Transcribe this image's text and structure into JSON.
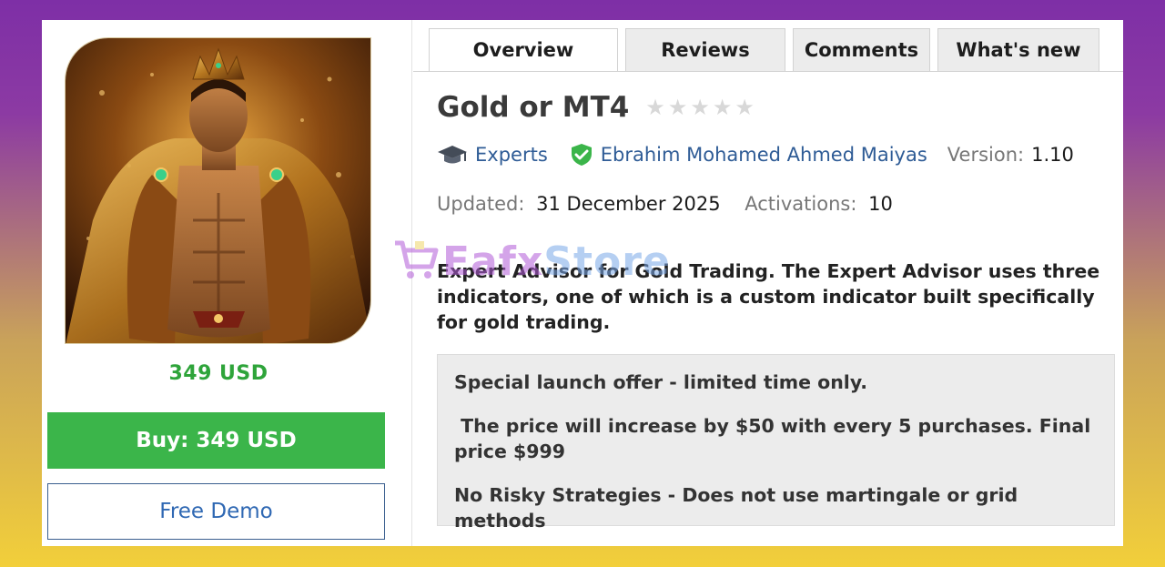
{
  "tabs": [
    {
      "label": "Overview",
      "active": true
    },
    {
      "label": "Reviews",
      "active": false
    },
    {
      "label": "Comments",
      "active": false
    },
    {
      "label": "What's new",
      "active": false
    }
  ],
  "product": {
    "title": "Gold or MT4",
    "rating_stars": 5,
    "rating_value": 0,
    "category": "Experts",
    "author": "Ebrahim Mohamed Ahmed Maiyas",
    "version_label": "Version:",
    "version": "1.10",
    "updated_label": "Updated:",
    "updated": "31 December 2025",
    "activations_label": "Activations:",
    "activations": "10",
    "price": "349 USD",
    "buy_label": "Buy: 349 USD",
    "demo_label": "Free Demo",
    "description": "Expert Advisor for Gold Trading. The Expert Advisor uses three indicators, one of which is a custom indicator built specifically for gold trading."
  },
  "offer": {
    "line1": "Special launch offer - limited time only.",
    "line2": " The price will increase by $50 with every 5 purchases. Final price $999",
    "line3": "No Risky Strategies - Does not use martingale or grid methods"
  },
  "watermark": {
    "part1": "Eafx",
    "part2": "Store"
  },
  "colors": {
    "price_green": "#2ea43a",
    "buy_button": "#3bb54a",
    "link_blue": "#2f5c96",
    "verified_green": "#3bb54a"
  },
  "icons": [
    "graduation-cap-icon",
    "verified-shield-icon",
    "star-icon",
    "cart-icon"
  ]
}
